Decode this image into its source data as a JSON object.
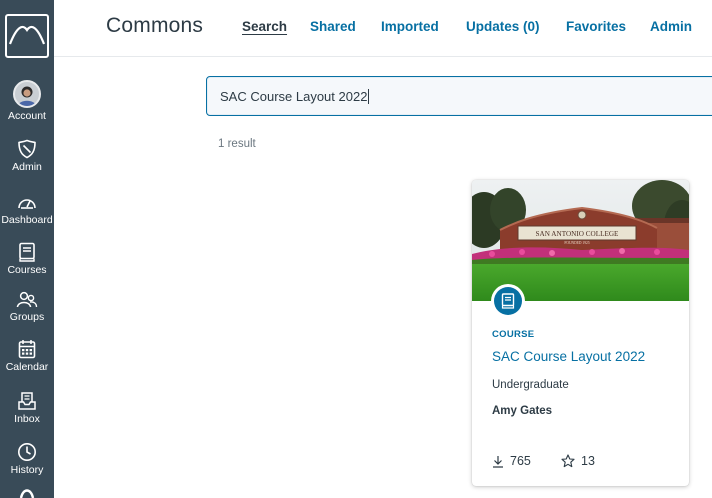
{
  "app": {
    "title": "Commons"
  },
  "nav": {
    "items": [
      {
        "label": "Account",
        "icon": "avatar"
      },
      {
        "label": "Admin",
        "icon": "shield-icon"
      },
      {
        "label": "Dashboard",
        "icon": "dashboard-icon"
      },
      {
        "label": "Courses",
        "icon": "book-icon"
      },
      {
        "label": "Groups",
        "icon": "groups-icon"
      },
      {
        "label": "Calendar",
        "icon": "calendar-icon"
      },
      {
        "label": "Inbox",
        "icon": "inbox-icon"
      },
      {
        "label": "History",
        "icon": "clock-icon"
      }
    ]
  },
  "tabs": [
    {
      "label": "Search",
      "active": true
    },
    {
      "label": "Shared",
      "active": false
    },
    {
      "label": "Imported",
      "active": false
    },
    {
      "label": "Updates (0)",
      "active": false
    },
    {
      "label": "Favorites",
      "active": false
    },
    {
      "label": "Admin",
      "active": false
    }
  ],
  "search": {
    "value": "SAC Course Layout 2022"
  },
  "results": {
    "count_text": "1 result"
  },
  "card": {
    "type": "COURSE",
    "title": "SAC Course Layout 2022",
    "subtitle": "Undergraduate",
    "author": "Amy Gates",
    "downloads": "765",
    "favorites": "13",
    "image_sign": "SAN ANTONIO COLLEGE",
    "image_sign_sub": "FOUNDED 1925"
  },
  "colors": {
    "rail": "#394b58",
    "link": "#0770a3",
    "text": "#2d3b45"
  }
}
